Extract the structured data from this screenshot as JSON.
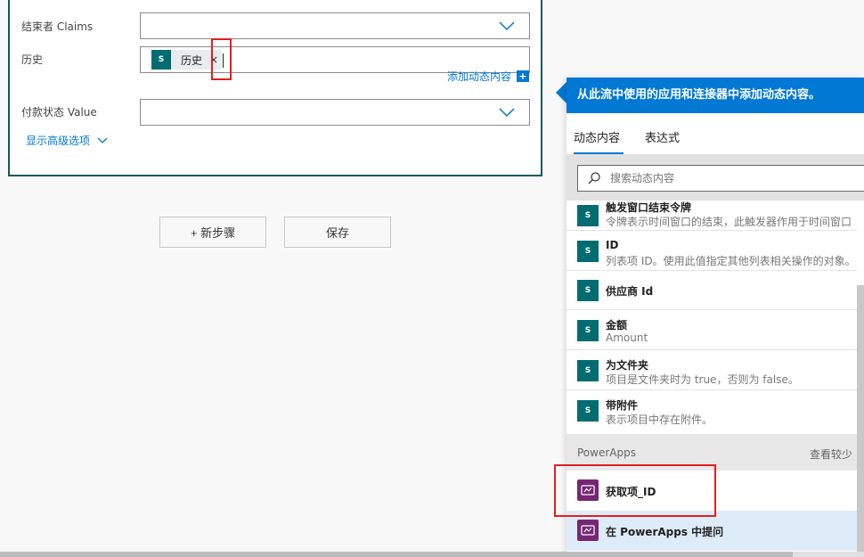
{
  "form": {
    "fields": [
      {
        "label": "结束者 Claims",
        "type": "dropdown"
      },
      {
        "label": "历史",
        "type": "token",
        "token_label": "历史",
        "token_remove": "×"
      },
      {
        "label": "付款状态 Value",
        "type": "dropdown"
      }
    ],
    "add_dynamic_content": "添加动态内容",
    "add_dynamic_plus": "+",
    "show_advanced": "显示高级选项"
  },
  "actions": {
    "new_step": "+ 新步骤",
    "save": "保存"
  },
  "panel": {
    "header": "从此流中使用的应用和连接器中添加动态内容。",
    "tabs": [
      "动态内容",
      "表达式"
    ],
    "search_placeholder": "搜索动态内容",
    "sp_icon_text": "S",
    "items": [
      {
        "title": "触发窗口结束令牌",
        "subtitle": "令牌表示时间窗口的结束，此触发器作用于时间窗口"
      },
      {
        "title": "ID",
        "subtitle": "列表项 ID。使用此值指定其他列表相关操作的对象。"
      },
      {
        "title": "供应商 Id",
        "subtitle": ""
      },
      {
        "title": "金额",
        "subtitle": "Amount"
      },
      {
        "title": "为文件夹",
        "subtitle": "项目是文件夹时为 true，否则为 false。"
      },
      {
        "title": "带附件",
        "subtitle": "表示项目中存在附件。"
      }
    ],
    "section": {
      "name": "PowerApps",
      "toggle": "查看较少"
    },
    "powerapps_items": [
      {
        "title": "获取项_ID"
      },
      {
        "title": "在 PowerApps 中提问"
      }
    ]
  },
  "colors": {
    "accent": "#0078d4",
    "card_border": "#0f5a5c",
    "sharepoint": "#036c70",
    "powerapps": "#742774",
    "highlight": "#e02020"
  }
}
